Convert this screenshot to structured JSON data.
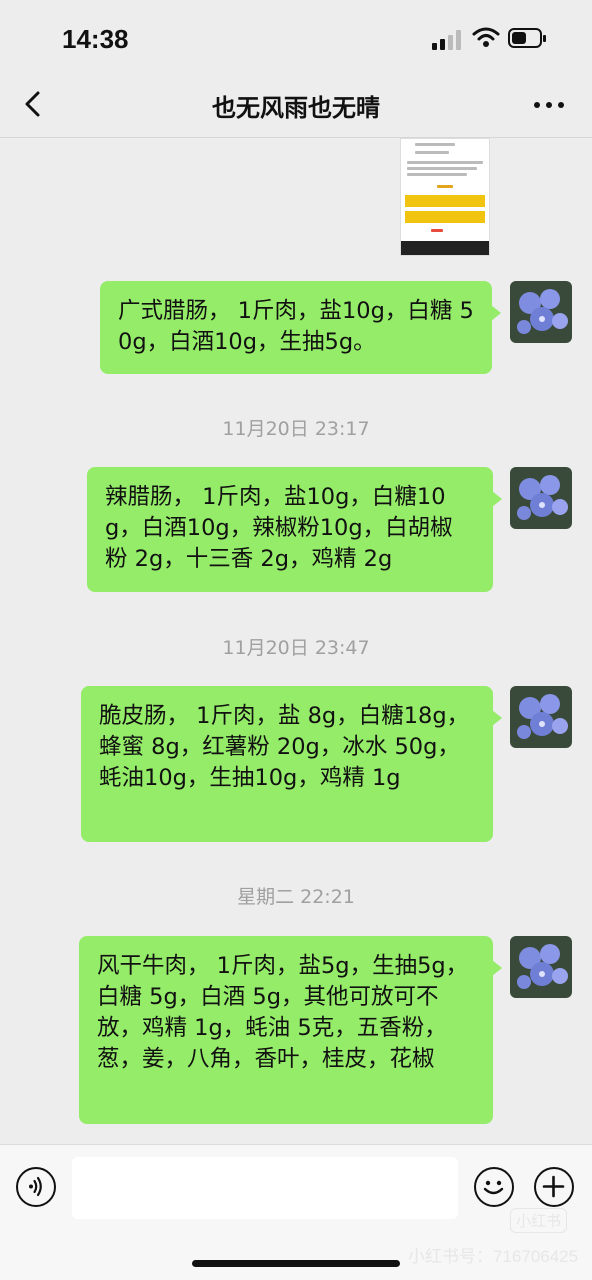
{
  "status_bar": {
    "time": "14:38"
  },
  "header": {
    "title": "也无风雨也无晴"
  },
  "messages": [
    {
      "text": "广式腊肠， 1斤肉，盐10g，白糖 50g，白酒10g，生抽5g。"
    },
    {
      "timestamp": "11月20日 23:17",
      "text": "辣腊肠， 1斤肉，盐10g，白糖10g，白酒10g，辣椒粉10g，白胡椒粉 2g，十三香 2g，鸡精 2g"
    },
    {
      "timestamp": "11月20日 23:47",
      "text": "脆皮肠，  1斤肉，盐 8g，白糖18g，蜂蜜 8g，红薯粉 20g，冰水 50g，蚝油10g，生抽10g，鸡精 1g"
    },
    {
      "timestamp": "星期二 22:21",
      "text": "风干牛肉， 1斤肉，盐5g，生抽5g，白糖 5g，白酒 5g，其他可放可不放，鸡精 1g，蚝油 5克，五香粉，葱，姜，八角，香叶，桂皮，花椒"
    }
  ],
  "watermark": {
    "logo": "小红书",
    "id": "小红书号：716706425"
  },
  "colors": {
    "bubble": "#95ec69",
    "background": "#ededed"
  }
}
